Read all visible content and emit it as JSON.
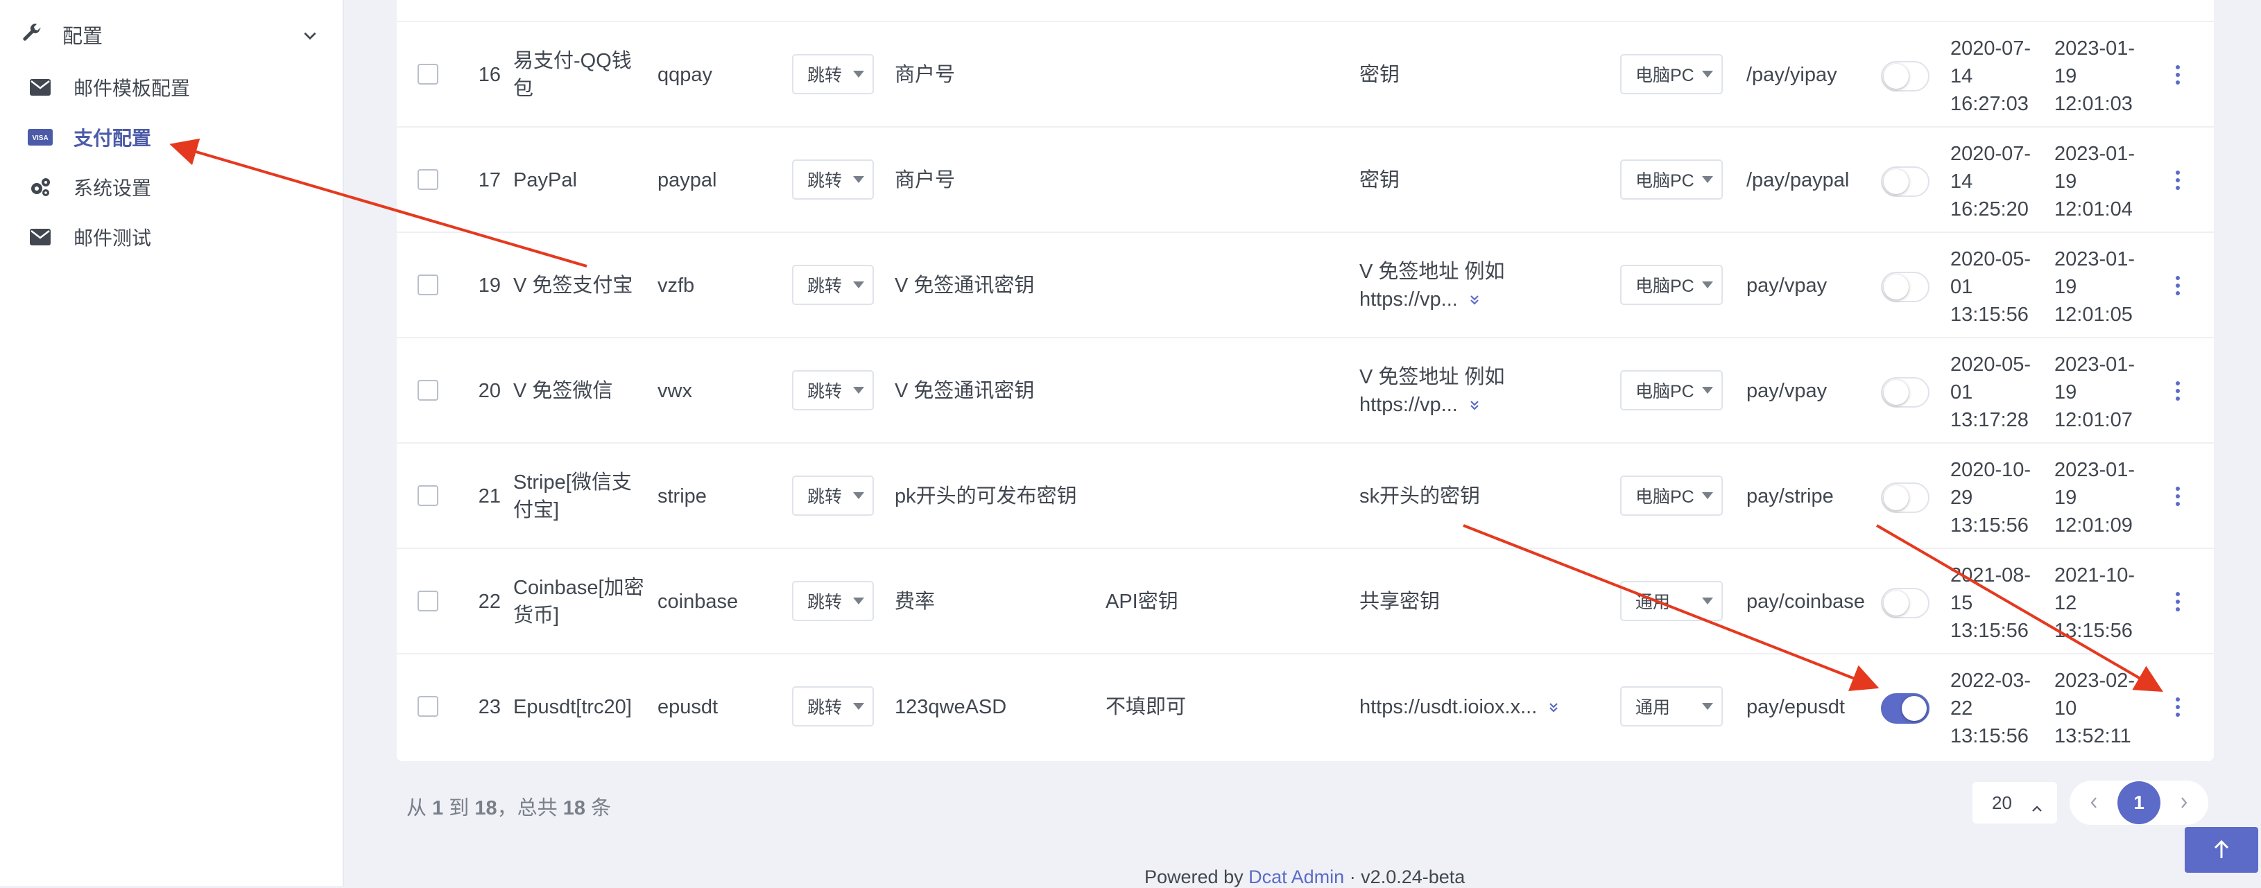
{
  "sidebar": {
    "group_label": "配置",
    "group_icon": "wrench-icon",
    "items": [
      {
        "label": "邮件模板配置",
        "icon": "envelope-icon",
        "active": false
      },
      {
        "label": "支付配置",
        "icon": "visa-card-icon",
        "active": true
      },
      {
        "label": "系统设置",
        "icon": "gears-icon",
        "active": false
      },
      {
        "label": "邮件测试",
        "icon": "envelope-icon",
        "active": false
      }
    ]
  },
  "table": {
    "rows": [
      {
        "id": "16",
        "name": "易支付-QQ钱包",
        "code": "qqpay",
        "method": "跳转",
        "merchant": "商户号",
        "key": "",
        "secret": "密钥",
        "secret_expandable": false,
        "type": "电脑PC",
        "route": "/pay/yipay",
        "enabled": false,
        "created": "2020-07-14 16:27:03",
        "updated": "2023-01-19 12:01:03"
      },
      {
        "id": "17",
        "name": "PayPal",
        "code": "paypal",
        "method": "跳转",
        "merchant": "商户号",
        "key": "",
        "secret": "密钥",
        "secret_expandable": false,
        "type": "电脑PC",
        "route": "/pay/paypal",
        "enabled": false,
        "created": "2020-07-14 16:25:20",
        "updated": "2023-01-19 12:01:04"
      },
      {
        "id": "19",
        "name": "V 免签支付宝",
        "code": "vzfb",
        "method": "跳转",
        "merchant": "V 免签通讯密钥",
        "key": "",
        "secret": "V 免签地址 例如 https://vp...",
        "secret_expandable": true,
        "type": "电脑PC",
        "route": "pay/vpay",
        "enabled": false,
        "created": "2020-05-01 13:15:56",
        "updated": "2023-01-19 12:01:05"
      },
      {
        "id": "20",
        "name": "V 免签微信",
        "code": "vwx",
        "method": "跳转",
        "merchant": "V 免签通讯密钥",
        "key": "",
        "secret": "V 免签地址 例如 https://vp...",
        "secret_expandable": true,
        "type": "电脑PC",
        "route": "pay/vpay",
        "enabled": false,
        "created": "2020-05-01 13:17:28",
        "updated": "2023-01-19 12:01:07"
      },
      {
        "id": "21",
        "name": "Stripe[微信支付宝]",
        "code": "stripe",
        "method": "跳转",
        "merchant": "pk开头的可发布密钥",
        "key": "",
        "secret": "sk开头的密钥",
        "secret_expandable": false,
        "type": "电脑PC",
        "route": "pay/stripe",
        "enabled": false,
        "created": "2020-10-29 13:15:56",
        "updated": "2023-01-19 12:01:09"
      },
      {
        "id": "22",
        "name": "Coinbase[加密货币]",
        "code": "coinbase",
        "method": "跳转",
        "merchant": "费率",
        "key": "API密钥",
        "secret": "共享密钥",
        "secret_expandable": false,
        "type": "通用",
        "route": "pay/coinbase",
        "enabled": false,
        "created": "2021-08-15 13:15:56",
        "updated": "2021-10-12 13:15:56"
      },
      {
        "id": "23",
        "name": "Epusdt[trc20]",
        "code": "epusdt",
        "method": "跳转",
        "merchant": "123qweASD",
        "key": "不填即可",
        "secret": "https://usdt.ioiox.x...",
        "secret_expandable": true,
        "type": "通用",
        "route": "pay/epusdt",
        "enabled": true,
        "created": "2022-03-22 13:15:56",
        "updated": "2023-02-10 13:52:11"
      }
    ]
  },
  "footer": {
    "from_label": "从",
    "from": "1",
    "to_label": "到",
    "to": "18",
    "total_label": "，总共",
    "total": "18",
    "unit": "条",
    "per_page": "20",
    "current_page": "1",
    "powered_prefix": "Powered by",
    "powered_link": "Dcat Admin",
    "version": "·  v2.0.24-beta"
  },
  "colors": {
    "accent": "#5b6bc7",
    "annotation_arrow": "#e5391f",
    "page_bg": "#eff1f6"
  }
}
